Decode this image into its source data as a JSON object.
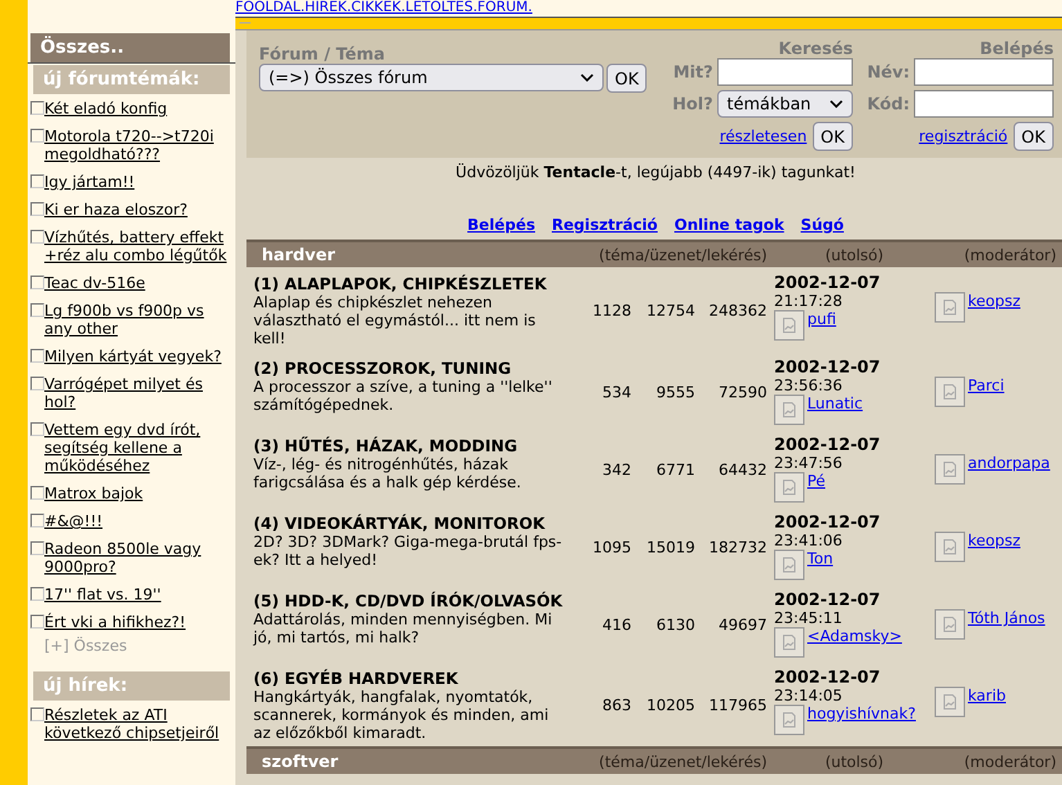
{
  "top_nav": "FOOLDAL.HIREK.CIKKEK.LETOLTES.FORUM.",
  "sidebar": {
    "header": "Összes..",
    "sections": [
      {
        "title": "új fórumtémák:",
        "more": "[+] Összes",
        "items": [
          "Két eladó konfig",
          "Motorola t720-->t720i megoldható???",
          "Igy jártam!!",
          "Ki er haza eloszor?",
          "Vízhűtés, battery effekt +réz alu combo légűtők",
          "Teac dv-516e",
          "Lg f900b vs f900p vs any other",
          "Milyen kártyát vegyek?",
          "Varrógépet milyet és hol?",
          "Vettem egy dvd írót, segítség kellene a működéséhez",
          "Matrox bajok",
          "#&@!!!",
          "Radeon 8500le vagy 9000pro?",
          "17'' flat vs. 19''",
          "Ért vki a hifikhez?!"
        ]
      },
      {
        "title": "új hírek:",
        "items": [
          "Részletek az ATI következő chipsetjeiről"
        ]
      }
    ]
  },
  "search_panel": {
    "forum": {
      "label": "Fórum / Téma",
      "value": "(=>) Összes fórum",
      "button": "OK"
    },
    "search": {
      "title": "Keresés",
      "what_label": "Mit?",
      "where_label": "Hol?",
      "where_value": "témákban",
      "link": "részletesen",
      "button": "OK"
    },
    "login": {
      "title": "Belépés",
      "name_label": "Név:",
      "code_label": "Kód:",
      "link": "regisztráció",
      "button": "OK"
    }
  },
  "welcome": "Üdvözöljük **Tentacle**-t, legújabb (4497-ik) tagunkat!",
  "links": [
    "Belépés",
    "Regisztráció",
    "Online tagok",
    "Súgó"
  ],
  "categories": [
    {
      "name": "hardver",
      "columns": [
        "(téma/üzenet/lekérés)",
        "(utolsó)",
        "(moderátor)"
      ],
      "forums": [
        {
          "title": "(1) ALAPLAPOK, CHIPKÉSZLETEK",
          "description": "Alaplap és chipkészlet nehezen választható el egymástól... itt nem is kell!",
          "topics": "1128",
          "messages": "12754",
          "views": "248362",
          "last_date": "2002-12-07",
          "last_time": "21:17:28",
          "last_user": "pufi",
          "moderator": "keopsz"
        },
        {
          "title": "(2) PROCESSZOROK, TUNING",
          "description": "A processzor a szíve, a tuning a ''lelke'' számítógépednek.",
          "topics": "534",
          "messages": "9555",
          "views": "72590",
          "last_date": "2002-12-07",
          "last_time": "23:56:36",
          "last_user": "Lunatic",
          "moderator": "Parci"
        },
        {
          "title": "(3) HŰTÉS, HÁZAK, MODDING",
          "description": "Víz-, lég- és nitrogénhűtés, házak farigcsálása és a halk gép kérdése.",
          "topics": "342",
          "messages": "6771",
          "views": "64432",
          "last_date": "2002-12-07",
          "last_time": "23:47:56",
          "last_user": "Pé",
          "moderator": "andorpapa"
        },
        {
          "title": "(4) VIDEOKÁRTYÁK, MONITOROK",
          "description": "2D? 3D? 3DMark? Giga-mega-brutál fps-ek? Itt a helyed!",
          "topics": "1095",
          "messages": "15019",
          "views": "182732",
          "last_date": "2002-12-07",
          "last_time": "23:41:06",
          "last_user": "Ton",
          "moderator": "keopsz"
        },
        {
          "title": "(5) HDD-K, CD/DVD ÍRÓK/OLVASÓK",
          "description": "Adattárolás, minden mennyiségben. Mi jó, mi tartós, mi halk?",
          "topics": "416",
          "messages": "6130",
          "views": "49697",
          "last_date": "2002-12-07",
          "last_time": "23:45:11",
          "last_user": "<Adamsky>",
          "moderator": "Tóth János"
        },
        {
          "title": "(6) EGYÉB HARDVEREK",
          "description": "Hangkártyák, hangfalak, nyomtatók, scannerek, kormányok és minden, ami az előzőkből kimaradt.",
          "topics": "863",
          "messages": "10205",
          "views": "117965",
          "last_date": "2002-12-07",
          "last_time": "23:14:05",
          "last_user": "hogyishívnak?",
          "moderator": "karib"
        }
      ]
    },
    {
      "name": "szoftver",
      "columns": [
        "(téma/üzenet/lekérés)",
        "(utolsó)",
        "(moderátor)"
      ]
    }
  ]
}
